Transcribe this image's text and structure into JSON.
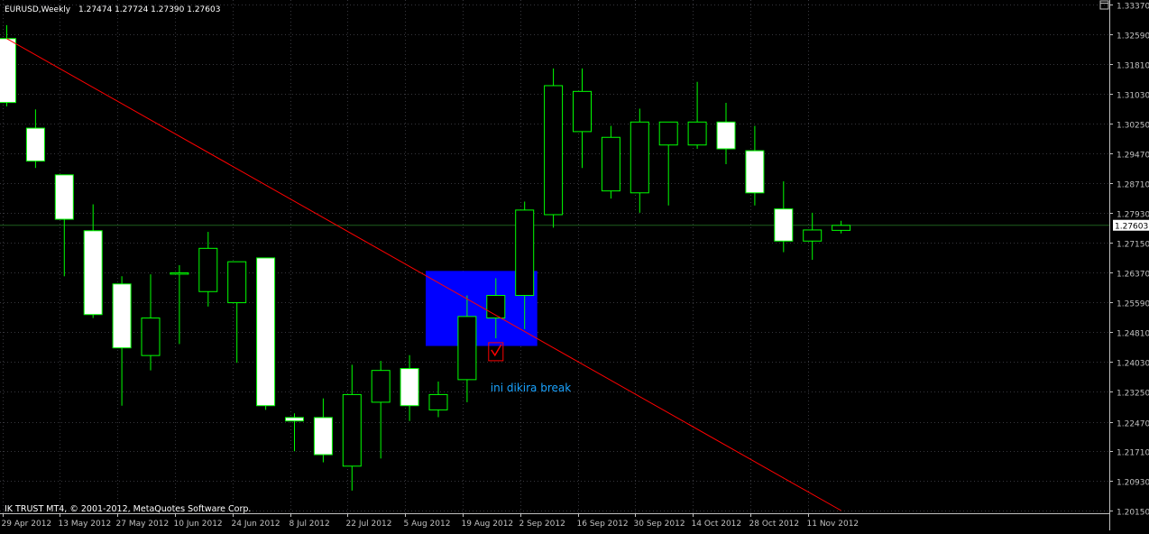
{
  "header": {
    "symbol": "EURUSD,Weekly",
    "ohlc": "1.27474 1.27724 1.27390 1.27603"
  },
  "copyright": "IK TRUST MT4, © 2001-2012, MetaQuotes Software Corp.",
  "annotation": {
    "text": "ini dikira break",
    "color": "#1aa3ff"
  },
  "colors": {
    "background": "#000000",
    "grid": "#37373d",
    "axis": "#c0c0c0",
    "bull_outline": "#00ff00",
    "bull_fill": "#000000",
    "bear_fill": "#ffffff",
    "trendline": "#ff0000",
    "zone": "#0000ff",
    "current_price_line": "#1e5f1e",
    "marker": "#ff0000"
  },
  "chart_data": {
    "type": "candlestick",
    "timeframe": "Weekly",
    "symbol": "EURUSD",
    "grid": true,
    "price_ticks": [
      "1.33370",
      "1.32590",
      "1.31810",
      "1.31030",
      "1.30250",
      "1.29470",
      "1.28710",
      "1.27930",
      "1.27150",
      "1.26370",
      "1.25590",
      "1.24810",
      "1.24030",
      "1.23250",
      "1.22470",
      "1.21710",
      "1.20930",
      "1.20150"
    ],
    "time_ticks": [
      "29 Apr 2012",
      "13 May 2012",
      "27 May 2012",
      "10 Jun 2012",
      "24 Jun 2012",
      "8 Jul 2012",
      "22 Jul 2012",
      "5 Aug 2012",
      "19 Aug 2012",
      "2 Sep 2012",
      "16 Sep 2012",
      "30 Sep 2012",
      "14 Oct 2012",
      "28 Oct 2012",
      "11 Nov 2012"
    ],
    "ylim": [
      1.2015,
      1.3337
    ],
    "current_price": "1.27603",
    "candles": [
      {
        "o": 1.3248,
        "h": 1.3283,
        "l": 1.3071,
        "c": 1.3081
      },
      {
        "o": 1.3014,
        "h": 1.3063,
        "l": 1.291,
        "c": 1.2928
      },
      {
        "o": 1.2892,
        "h": 1.2892,
        "l": 1.2627,
        "c": 1.2776
      },
      {
        "o": 1.2746,
        "h": 1.2815,
        "l": 1.2518,
        "c": 1.2527
      },
      {
        "o": 1.2607,
        "h": 1.2627,
        "l": 1.2289,
        "c": 1.244
      },
      {
        "o": 1.242,
        "h": 1.2632,
        "l": 1.2381,
        "c": 1.2518
      },
      {
        "o": 1.2636,
        "h": 1.2656,
        "l": 1.245,
        "c": 1.2636
      },
      {
        "o": 1.2587,
        "h": 1.2743,
        "l": 1.2548,
        "c": 1.27
      },
      {
        "o": 1.2558,
        "h": 1.2665,
        "l": 1.2401,
        "c": 1.2665
      },
      {
        "o": 1.2675,
        "h": 1.2675,
        "l": 1.2278,
        "c": 1.2289
      },
      {
        "o": 1.2258,
        "h": 1.2269,
        "l": 1.217,
        "c": 1.2249
      },
      {
        "o": 1.2258,
        "h": 1.2308,
        "l": 1.2141,
        "c": 1.2161
      },
      {
        "o": 1.2131,
        "h": 1.2396,
        "l": 1.2067,
        "c": 1.2318
      },
      {
        "o": 1.2298,
        "h": 1.2406,
        "l": 1.2151,
        "c": 1.2381
      },
      {
        "o": 1.2386,
        "h": 1.2421,
        "l": 1.2249,
        "c": 1.2289
      },
      {
        "o": 1.2278,
        "h": 1.2352,
        "l": 1.2259,
        "c": 1.2318
      },
      {
        "o": 1.2357,
        "h": 1.2577,
        "l": 1.2298,
        "c": 1.2522
      },
      {
        "o": 1.2518,
        "h": 1.2622,
        "l": 1.2465,
        "c": 1.2577
      },
      {
        "o": 1.2577,
        "h": 1.2822,
        "l": 1.2489,
        "c": 1.28
      },
      {
        "o": 1.2788,
        "h": 1.317,
        "l": 1.2754,
        "c": 1.3125
      },
      {
        "o": 1.3005,
        "h": 1.317,
        "l": 1.291,
        "c": 1.311
      },
      {
        "o": 1.285,
        "h": 1.302,
        "l": 1.283,
        "c": 1.299
      },
      {
        "o": 1.2845,
        "h": 1.3065,
        "l": 1.2793,
        "c": 1.303
      },
      {
        "o": 1.297,
        "h": 1.303,
        "l": 1.2812,
        "c": 1.303
      },
      {
        "o": 1.297,
        "h": 1.3135,
        "l": 1.296,
        "c": 1.303
      },
      {
        "o": 1.303,
        "h": 1.308,
        "l": 1.292,
        "c": 1.296
      },
      {
        "o": 1.2955,
        "h": 1.302,
        "l": 1.2812,
        "c": 1.2845
      },
      {
        "o": 1.2803,
        "h": 1.2875,
        "l": 1.269,
        "c": 1.2719
      },
      {
        "o": 1.2719,
        "h": 1.2793,
        "l": 1.267,
        "c": 1.2748
      },
      {
        "o": 1.2747,
        "h": 1.2772,
        "l": 1.2739,
        "c": 1.276
      }
    ],
    "trendline": [
      {
        "bar": 0,
        "price": 1.3248
      },
      {
        "bar": 29,
        "price": 1.2015
      }
    ],
    "zone": {
      "bar_from": 15,
      "bar_to": 18,
      "price_high": 1.2641,
      "price_low": 1.2445
    },
    "marker": {
      "bar": 17,
      "price": 1.243
    }
  }
}
